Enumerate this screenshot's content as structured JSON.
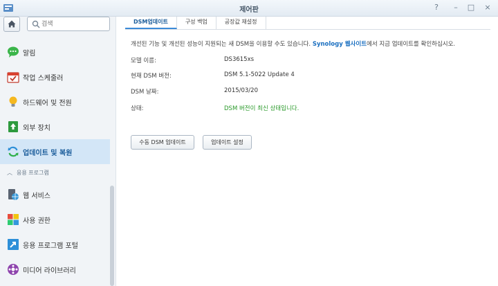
{
  "window": {
    "title": "제어판"
  },
  "sidebar": {
    "search_placeholder": "검색",
    "items": [
      {
        "label": "알림",
        "icon": "chat-bubble-icon"
      },
      {
        "label": "작업 스케줄러",
        "icon": "calendar-check-icon"
      },
      {
        "label": "하드웨어 및 전원",
        "icon": "lightbulb-icon"
      },
      {
        "label": "외부 장치",
        "icon": "external-device-icon"
      },
      {
        "label": "업데이트 및 복원",
        "icon": "refresh-icon",
        "active": true
      }
    ],
    "section_title": "응용 프로그램",
    "app_items": [
      {
        "label": "웹 서비스",
        "icon": "web-globe-icon"
      },
      {
        "label": "사용 권한",
        "icon": "permission-blocks-icon"
      },
      {
        "label": "응용 프로그램 포털",
        "icon": "portal-arrow-icon"
      },
      {
        "label": "미디어 라이브러리",
        "icon": "media-library-icon"
      }
    ]
  },
  "main": {
    "tabs": [
      {
        "label": "DSM업데이트",
        "active": true
      },
      {
        "label": "구성 백업"
      },
      {
        "label": "공장값 재설정"
      }
    ],
    "intro_text": "개선된 기능 및 개선된 성능이 지원되는 새 DSM을 이용할 수도 있습니다.",
    "intro_link": "Synology 웹사이트",
    "intro_suffix": "에서 지금 업데이트를 확인하십시오.",
    "info": [
      {
        "label": "모델 이름:",
        "value": "DS3615xs"
      },
      {
        "label": "현재 DSM 버전:",
        "value": "DSM 5.1-5022 Update 4"
      },
      {
        "label": "DSM 날짜:",
        "value": "2015/03/20"
      },
      {
        "label": "상태:",
        "value": "DSM 버전이 최신 상태입니다."
      }
    ],
    "buttons": {
      "manual_update": "수동 DSM 업데이트",
      "update_settings": "업데이트 설정"
    }
  },
  "colors": {
    "accent": "#1a5c9a",
    "status_ok": "#2a9a2a",
    "active_row": "#d3e6f7"
  }
}
